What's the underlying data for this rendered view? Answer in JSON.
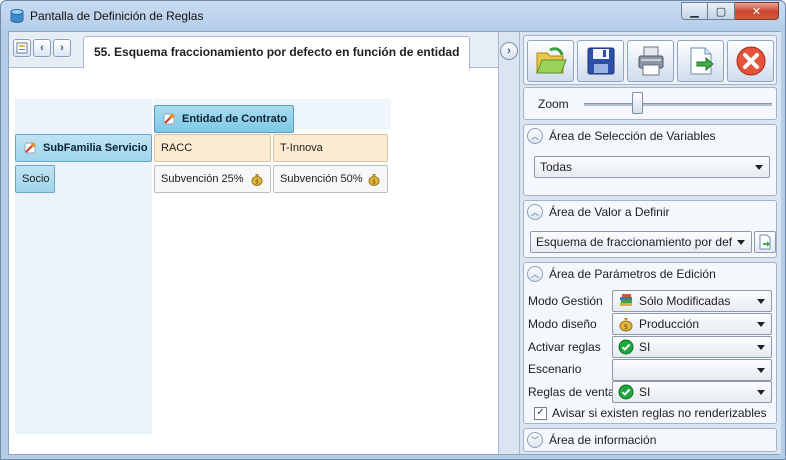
{
  "window": {
    "title": "Pantalla de Definición de Reglas",
    "icon": "database-icon",
    "buttons": [
      "minimize-icon",
      "maximize-icon",
      "close-icon"
    ]
  },
  "editor": {
    "tab_title": "55. Esquema fraccionamiento por defecto en función de entidad",
    "column_header": "Entidad de Contrato",
    "row_header": "SubFamilia Servicio",
    "columns": [
      "RACC",
      "T-Innova"
    ],
    "rows": [
      {
        "label": "Socio",
        "cells": [
          "Subvención 25%",
          "Subvención 50%"
        ]
      }
    ]
  },
  "toolbar": {
    "buttons": [
      "open-folder-icon",
      "save-icon",
      "printer-icon",
      "export-icon",
      "cancel-icon"
    ]
  },
  "zoom": {
    "label": "Zoom",
    "level": 0.27
  },
  "variables": {
    "title": "Área de Selección de Variables",
    "selected": "Todas"
  },
  "value_area": {
    "title": "Área de Valor a Definir",
    "selected": "Esquema de fraccionamiento por def"
  },
  "params": {
    "title": "Área de Parámetros de Edición",
    "modo_gestion_label": "Modo Gestión",
    "modo_gestion_value": "Sólo Modificadas",
    "modo_diseno_label": "Modo diseño",
    "modo_diseno_value": "Producción",
    "activar_label": "Activar reglas",
    "activar_value": "SI",
    "escenario_label": "Escenario",
    "escenario_value": "",
    "venta_label": "Reglas de venta",
    "venta_value": "SI",
    "avisar_label": "Avisar si existen reglas no renderizables",
    "avisar_checked": true
  },
  "info": {
    "title": "Área de información"
  },
  "colors": {
    "header_blue": "#8fd0ea",
    "peach": "#fdebd1",
    "accent_green": "#1ea83c",
    "close_red": "#c9452c"
  }
}
